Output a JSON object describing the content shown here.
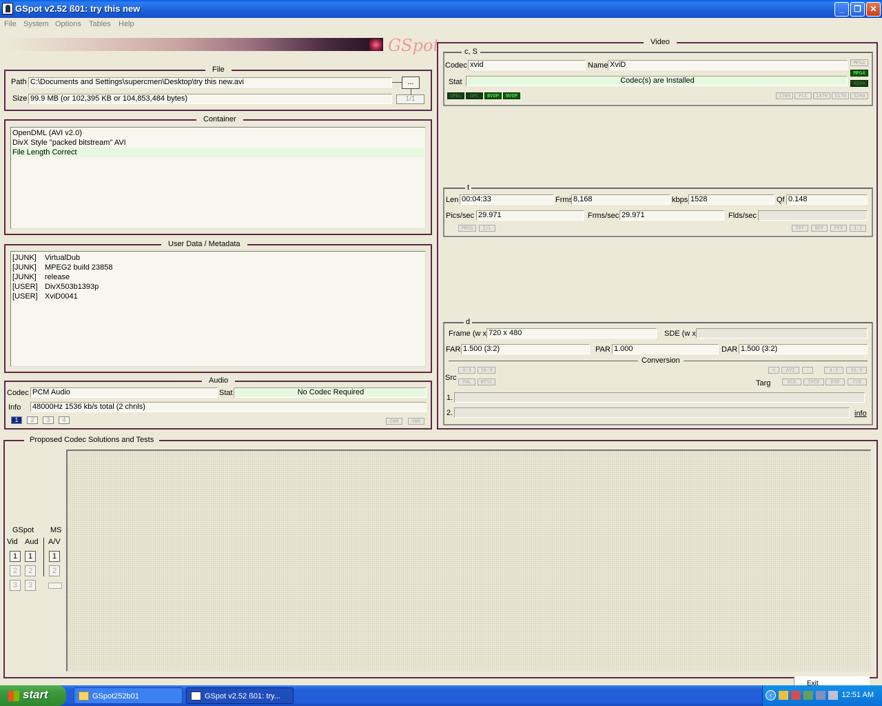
{
  "window": {
    "title": "GSpot v2.52 ß01: try this new"
  },
  "menu": [
    "File",
    "System",
    "Options",
    "Tables",
    "Help"
  ],
  "logo": "GSpot",
  "file": {
    "legend": "File",
    "path_label": "Path",
    "path": "C:\\Documents and Settings\\supercmen\\Desktop\\try this new.avi",
    "browse": "...",
    "size_label": "Size",
    "size": "99.9 MB (or 102,395 KB or 104,853,484 bytes)",
    "count": "1/1"
  },
  "container": {
    "legend": "Container",
    "lines": [
      "OpenDML (AVI v2.0)",
      "DivX Style \"packed bitstream\" AVI",
      "File Length Correct"
    ]
  },
  "metadata": {
    "legend": "User Data / Metadata",
    "rows": [
      [
        "[JUNK]",
        "VirtualDub"
      ],
      [
        "[JUNK]",
        "MPEG2 build 23858"
      ],
      [
        "[JUNK]",
        "release"
      ],
      [
        "[USER]",
        "DivX503b1393p"
      ],
      [
        "[USER]",
        "XviD0041"
      ]
    ]
  },
  "audio": {
    "legend": "Audio",
    "codec_label": "Codec",
    "codec": "PCM Audio",
    "stat_label": "Stat",
    "stat": "No Codec Required",
    "info_label": "Info",
    "info": "48000Hz  1536 kb/s total (2 chnls)",
    "tracks": [
      "1",
      "2",
      "3",
      "4"
    ],
    "cbr": "CBR",
    "vbr": "VBR"
  },
  "video": {
    "legend": "Video",
    "cs": {
      "legend": "c, S",
      "codec_label": "Codec",
      "codec": "xvid",
      "name_label": "Name",
      "name": "XviD",
      "stat_label": "Stat",
      "stat": "Codec(s) are Installed",
      "tags_right": [
        "MPG2",
        "MPG4",
        "H264"
      ],
      "tags_left": [
        "QPEL",
        "GMC",
        "BVOP",
        "NVOP"
      ],
      "tags_bottom": [
        "1709",
        "FCC",
        "1470",
        "5170",
        "5240"
      ]
    },
    "t": {
      "legend": "t",
      "len_label": "Len",
      "len": "00:04:33",
      "frms_label": "Frms",
      "frms": "8,168",
      "kbps_label": "kbps",
      "kbps": "1528",
      "qf_label": "Qf",
      "qf": "0.148",
      "pics_label": "Pics/sec",
      "pics": "29.971",
      "frmsec_label": "Frms/sec",
      "frmsec": "29.971",
      "flds_label": "Flds/sec",
      "tags_left": [
        "PROG",
        "I/L"
      ],
      "tags_right": [
        "TFF",
        "BFF",
        "PFF",
        "3:2"
      ]
    },
    "d": {
      "legend": "d",
      "frame_label": "Frame (w x",
      "frame": "720 x 480",
      "sde_label": "SDE (w x",
      "far_label": "FAR",
      "far": "1.500 (3:2)",
      "par_label": "PAR",
      "par": "1.000",
      "dar_label": "DAR",
      "dar": "1.500 (3:2)",
      "conversion": "Conversion",
      "src_label": "Src",
      "src_tags": [
        "4:3",
        "16:9",
        "PAL",
        "NTSC"
      ],
      "targ_label": "Targ",
      "targ_top": [
        "+",
        "AVI",
        "-",
        "4:3",
        "16:9"
      ],
      "targ_bottom": [
        "VCD",
        "SVCD",
        "DVD",
        "CVD"
      ],
      "row1": "1.",
      "row2": "2.",
      "info_link": "info"
    }
  },
  "proposed": {
    "legend": "Proposed Codec Solutions and Tests",
    "gspot": "GSpot",
    "ms": "MS",
    "vid": "Vid",
    "aud": "Aud",
    "av": "A/V",
    "nums": [
      "1",
      "2",
      "3"
    ]
  },
  "taskbar": {
    "start": "start",
    "tasks": [
      "GSpot252b01",
      "GSpot v2.52 ß01: try..."
    ],
    "clock": "12:51 AM",
    "tip": "Exit"
  }
}
